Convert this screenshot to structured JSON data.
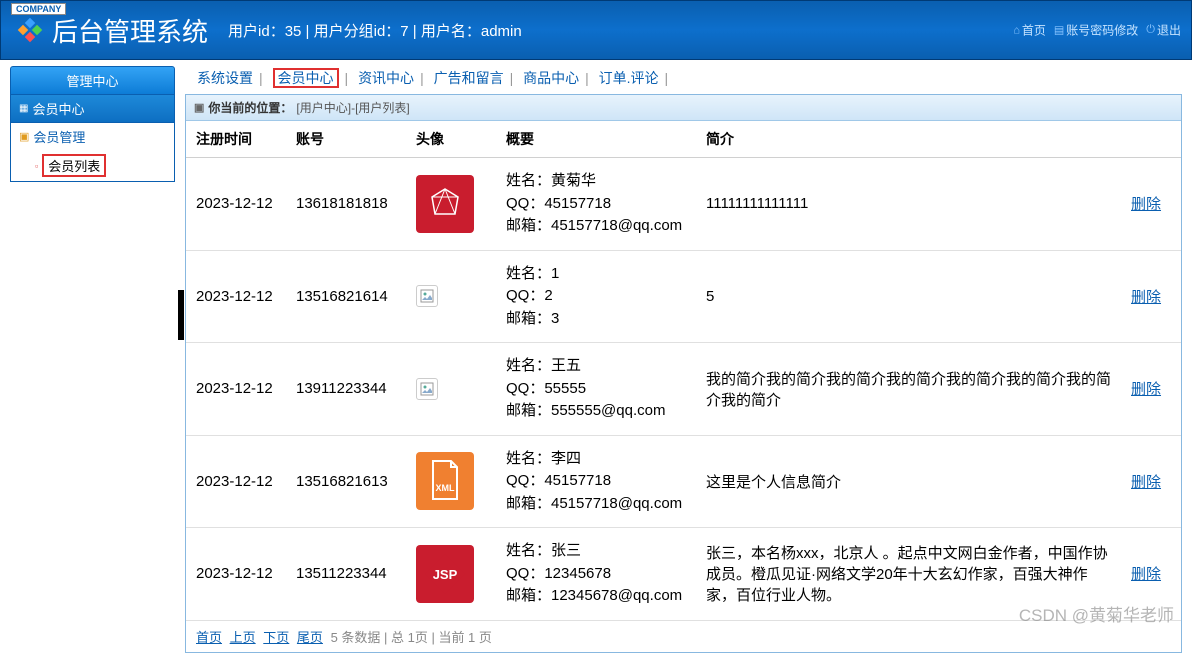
{
  "header": {
    "company_tag": "COMPANY",
    "title": "后台管理系统",
    "user_info": "用户id：35 | 用户分组id：7 | 用户名：admin",
    "links": {
      "home": "首页",
      "pwd": "账号密码修改",
      "logout": "退出"
    }
  },
  "tabs": {
    "sys": "系统设置",
    "member": "会员中心",
    "news": "资讯中心",
    "ad": "广告和留言",
    "goods": "商品中心",
    "order": "订单.评论"
  },
  "sidebar": {
    "title": "管理中心",
    "section": "会员中心",
    "group": "会员管理",
    "item": "会员列表"
  },
  "breadcrumb": {
    "label": "你当前的位置：",
    "path": "[用户中心]-[用户列表]"
  },
  "table": {
    "headers": {
      "regtime": "注册时间",
      "account": "账号",
      "avatar": "头像",
      "summary": "概要",
      "intro": "简介",
      "op": ""
    },
    "rows": [
      {
        "time": "2023-12-12",
        "account": "13618181818",
        "avatar_type": "ruby",
        "name": "黄菊华",
        "qq": "45157718",
        "email": "45157718@qq.com",
        "intro": "11111111111111"
      },
      {
        "time": "2023-12-12",
        "account": "13516821614",
        "avatar_type": "broken",
        "name": "1",
        "qq": "2",
        "email": "3",
        "intro": "5"
      },
      {
        "time": "2023-12-12",
        "account": "13911223344",
        "avatar_type": "broken",
        "name": "王五",
        "qq": "55555",
        "email": "555555@qq.com",
        "intro": "我的简介我的简介我的简介我的简介我的简介我的简介我的简介我的简介"
      },
      {
        "time": "2023-12-12",
        "account": "13516821613",
        "avatar_type": "xml",
        "name": "李四",
        "qq": "45157718",
        "email": "45157718@qq.com",
        "intro": "这里是个人信息简介"
      },
      {
        "time": "2023-12-12",
        "account": "13511223344",
        "avatar_type": "jsp",
        "name": "张三",
        "qq": "12345678",
        "email": "12345678@qq.com",
        "intro": "张三，本名杨xxx，北京人 。起点中文网白金作者，中国作协成员。橙瓜见证·网络文学20年十大玄幻作家，百强大神作家，百位行业人物。"
      }
    ],
    "delete_label": "删除",
    "summary_labels": {
      "name": "姓名：",
      "qq": "QQ：",
      "email": "邮箱："
    }
  },
  "pager": {
    "first": "首页",
    "prev": "上页",
    "next": "下页",
    "last": "尾页",
    "info": "5 条数据 | 总 1页 | 当前 1 页"
  },
  "watermark": "CSDN @黄菊华老师"
}
